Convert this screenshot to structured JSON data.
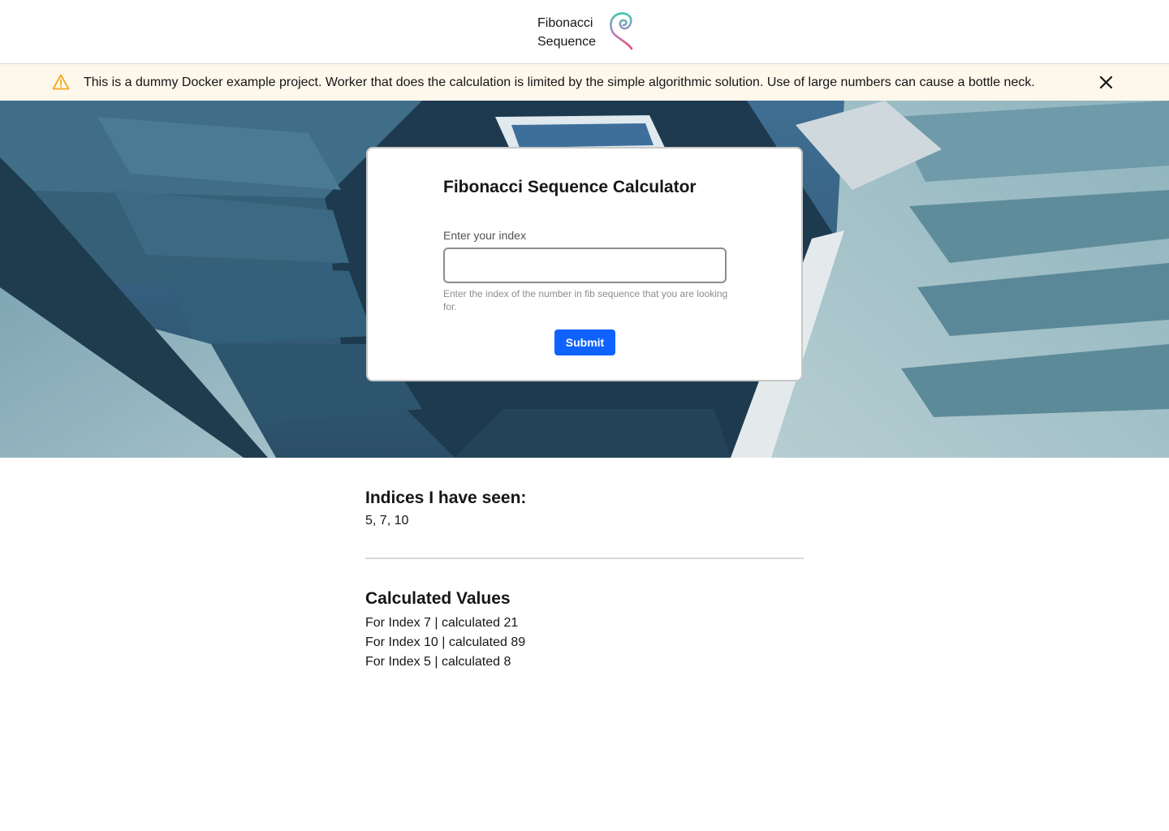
{
  "header": {
    "brand_line1": "Fibonacci",
    "brand_line2": "Sequence",
    "logo_icon": "spiral-logo-icon"
  },
  "banner": {
    "icon": "warning-icon",
    "message": "This is a dummy Docker example project. Worker that does the calculation is limited by the simple algorithmic solution. Use of large numbers can cause a bottle neck.",
    "close_icon": "close-icon",
    "background_color": "#fdf7ec",
    "warning_color": "#f1a81c"
  },
  "form": {
    "title": "Fibonacci Sequence Calculator",
    "label": "Enter your index",
    "value": "",
    "helper_text": "Enter the index of the number in fib sequence that you are looking for.",
    "submit_label": "Submit",
    "accent_color": "#0f62fe"
  },
  "indices": {
    "title": "Indices I have seen:",
    "values_text": "5, 7, 10"
  },
  "calculated": {
    "title": "Calculated Values",
    "items": [
      "For Index 7 | calculated 21",
      "For Index 10 | calculated 89",
      "For Index 5 | calculated 8"
    ]
  }
}
